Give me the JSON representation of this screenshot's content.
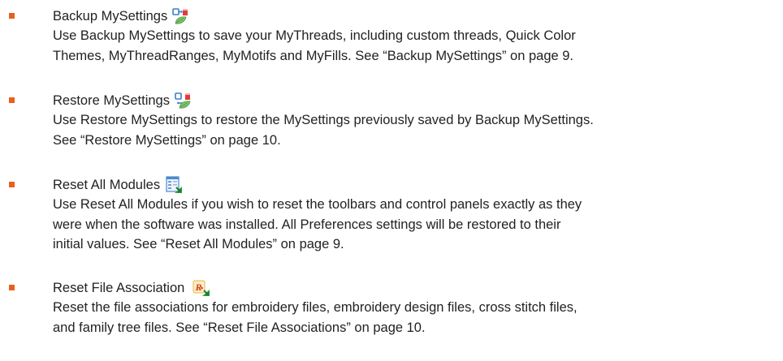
{
  "items": [
    {
      "title": "Backup MySettings",
      "icon": "backup-mysettings-icon",
      "description": "Use Backup MySettings to save your MyThreads, including custom threads, Quick Color\nThemes, MyThreadRanges, MyMotifs and MyFills. See “Backup MySettings” on page 9."
    },
    {
      "title": "Restore MySettings",
      "icon": "restore-mysettings-icon",
      "description": "Use Restore MySettings to restore the MySettings previously saved by Backup MySettings.\nSee “Restore MySettings” on page 10."
    },
    {
      "title": "Reset All Modules",
      "icon": "reset-all-modules-icon",
      "description": "Use Reset All Modules if you wish to reset the toolbars and control panels exactly as they\nwere when the software was installed. All Preferences settings will be restored to their\ninitial values. See “Reset All Modules” on page 9."
    },
    {
      "title": "Reset File Association",
      "icon": "reset-file-association-icon",
      "description": "Reset the file associations for embroidery files, embroidery design files, cross stitch files,\nand family tree files. See “Reset File Associations” on page 10."
    }
  ],
  "colors": {
    "bullet": "#e8601c",
    "text": "#222222"
  }
}
